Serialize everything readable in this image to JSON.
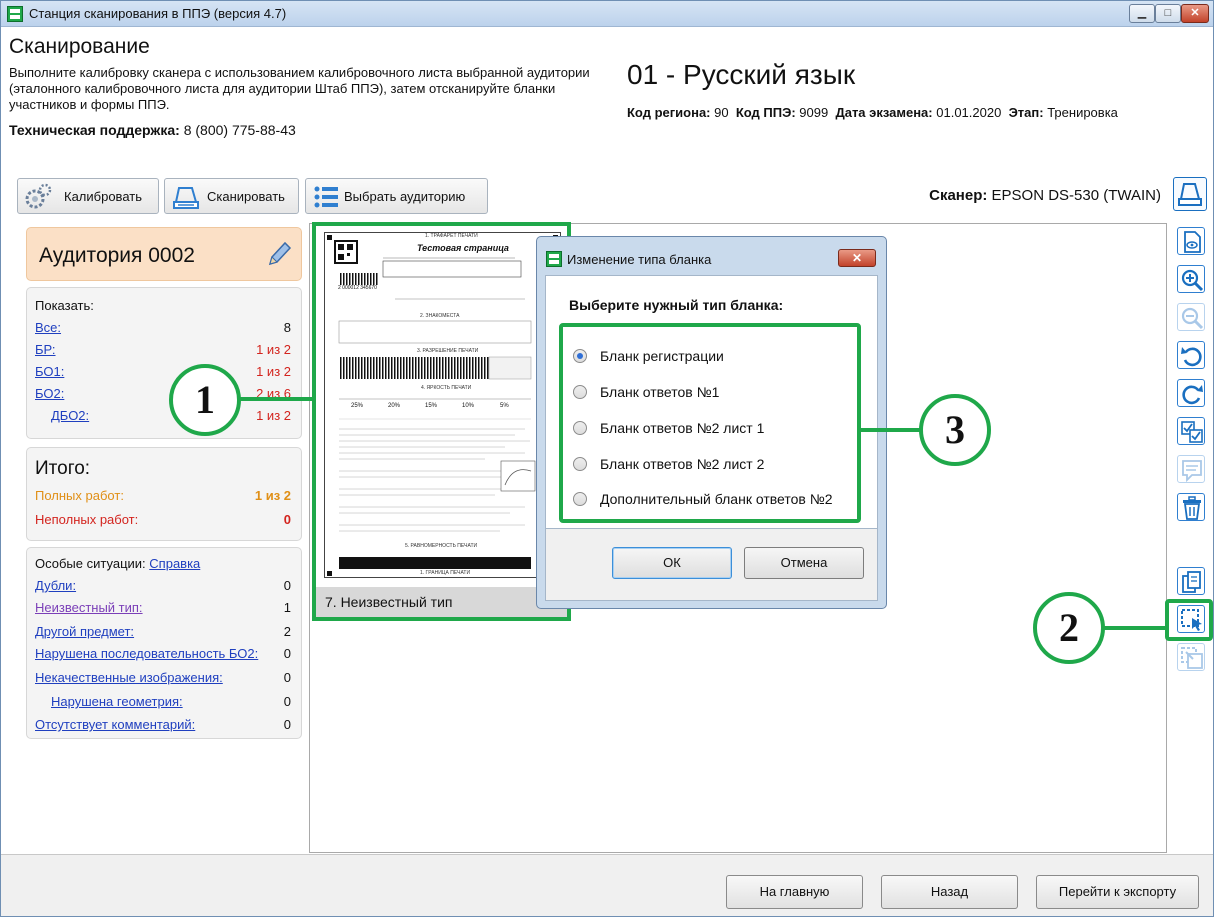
{
  "window": {
    "title": "Станция сканирования в ППЭ (версия 4.7)"
  },
  "header": {
    "title": "Сканирование",
    "description": "Выполните калибровку сканера с использованием калибровочного листа выбранной аудитории (эталонного калибровочного листа для аудитории Штаб ППЭ), затем отсканируйте бланки участников и формы ППЭ.",
    "support_label": "Техническая поддержка:",
    "support_phone": "8 (800) 775-88-43",
    "subject": "01 - Русский язык",
    "region_label": "Код региона:",
    "region": "90",
    "ppe_label": "Код ППЭ:",
    "ppe": "9099",
    "date_label": "Дата экзамена:",
    "date": "01.01.2020",
    "stage_label": "Этап:",
    "stage": "Тренировка"
  },
  "toolbar": {
    "calibrate": "Калибровать",
    "scan": "Сканировать",
    "select_room": "Выбрать аудиторию",
    "scanner_label": "Сканер:",
    "scanner_name": "EPSON DS-530 (TWAIN)"
  },
  "sidebar": {
    "room": "Аудитория 0002",
    "show_label": "Показать:",
    "counts": [
      {
        "label": "Все:",
        "value": "8"
      },
      {
        "label": "БР:",
        "value": "1 из 2"
      },
      {
        "label": "БО1:",
        "value": "1 из 2"
      },
      {
        "label": "БО2:",
        "value": "2 из 6"
      },
      {
        "label": "ДБО2:",
        "value": "1 из 2"
      }
    ],
    "total_label": "Итого:",
    "full_label": "Полных работ:",
    "full_value": "1 из 2",
    "partial_label": "Неполных работ:",
    "partial_value": "0",
    "special_label": "Особые ситуации:",
    "help_link": "Справка",
    "special": [
      {
        "label": "Дубли:",
        "value": "0"
      },
      {
        "label": "Неизвестный тип:",
        "value": "1"
      },
      {
        "label": "Другой предмет:",
        "value": "2"
      },
      {
        "label": "Нарушена последовательность БО2:",
        "value": "0"
      },
      {
        "label": "Некачественные изображения:",
        "value": "0"
      },
      {
        "label": "Нарушена геометрия:",
        "value": "0"
      },
      {
        "label": "Отсутствует комментарий:",
        "value": "0"
      }
    ]
  },
  "thumbnail": {
    "caption": "7. Неизвестный тип",
    "page_heading": "1. ТРАФАРЕТ ПЕЧАТИ",
    "page_title": "Тестовая страница",
    "barcode_number": "2 000012 345670",
    "section2": "2. ЗНАКОМЕСТА",
    "section3": "3. РАЗРЕШЕНИЕ ПЕЧАТИ",
    "section4": "4. ЯРКОСТЬ ПЕЧАТИ",
    "percents": [
      "25%",
      "20%",
      "15%",
      "10%",
      "5%"
    ],
    "section5": "5. РАВНОМЕРНОСТЬ ПЕЧАТИ",
    "footer": "1. ГРАНИЦА ПЕЧАТИ"
  },
  "dialog": {
    "title": "Изменение типа бланка",
    "question": "Выберите нужный тип бланка:",
    "options": [
      "Бланк регистрации",
      "Бланк ответов №1",
      "Бланк ответов №2 лист 1",
      "Бланк ответов №2 лист 2",
      "Дополнительный бланк ответов №2"
    ],
    "selected": 0,
    "ok": "ОК",
    "cancel": "Отмена"
  },
  "callouts": [
    "1",
    "2",
    "3"
  ],
  "footer": {
    "home": "На главную",
    "back": "Назад",
    "export": "Перейти к экспорту"
  },
  "colors": {
    "accent_green": "#1fa84a",
    "link": "#1f3fbf",
    "alert_red": "#d3241e",
    "warn_orange": "#e08f16",
    "room_bg": "#fbe0c6"
  }
}
